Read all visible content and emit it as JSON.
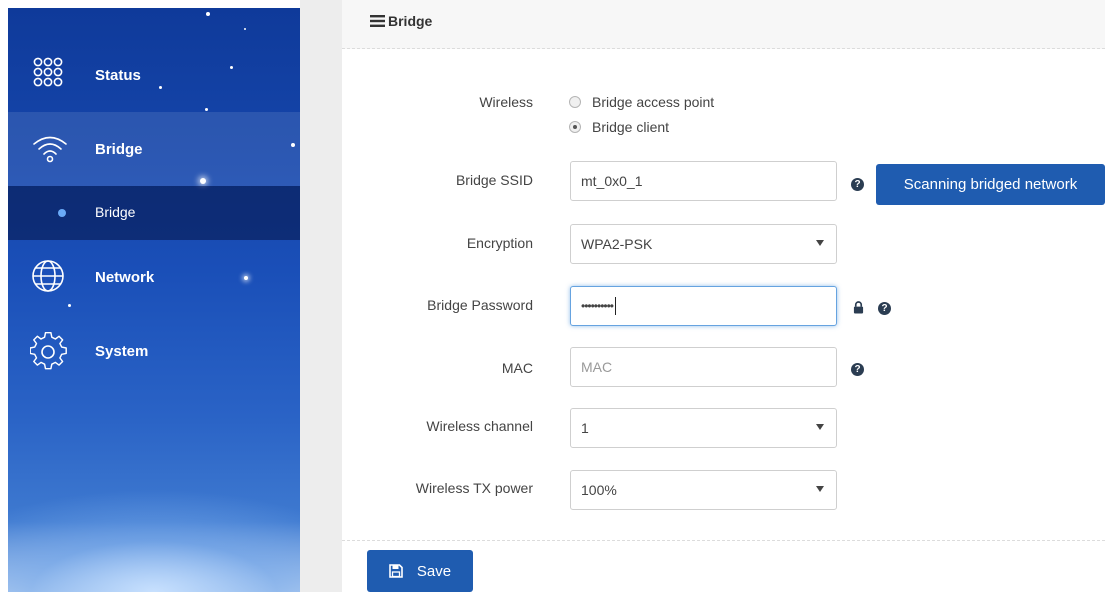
{
  "sidebar": {
    "items": [
      {
        "label": "Status",
        "icon": "grid-dots-icon"
      },
      {
        "label": "Bridge",
        "icon": "wifi-icon"
      },
      {
        "label": "Network",
        "icon": "globe-icon"
      },
      {
        "label": "System",
        "icon": "gear-icon"
      }
    ],
    "subitems": [
      {
        "label": "Bridge"
      }
    ]
  },
  "panel": {
    "title": "Bridge",
    "title_icon": "list-icon"
  },
  "form": {
    "wireless": {
      "label": "Wireless",
      "options": [
        "Bridge access point",
        "Bridge client"
      ],
      "selected": "Bridge client"
    },
    "ssid": {
      "label": "Bridge SSID",
      "value": "mt_0x0_1"
    },
    "scan_button": "Scanning bridged network",
    "encryption": {
      "label": "Encryption",
      "value": "WPA2-PSK"
    },
    "password": {
      "label": "Bridge Password",
      "masked_value": "••••••••••"
    },
    "mac": {
      "label": "MAC",
      "placeholder": "MAC",
      "value": ""
    },
    "channel": {
      "label": "Wireless channel",
      "value": "1"
    },
    "txpower": {
      "label": "Wireless TX power",
      "value": "100%"
    }
  },
  "save_button": "Save",
  "colors": {
    "primary_button": "#1f5cb0",
    "sidebar_dark": "#0f3a9a",
    "focus_border": "#66a3e0"
  }
}
